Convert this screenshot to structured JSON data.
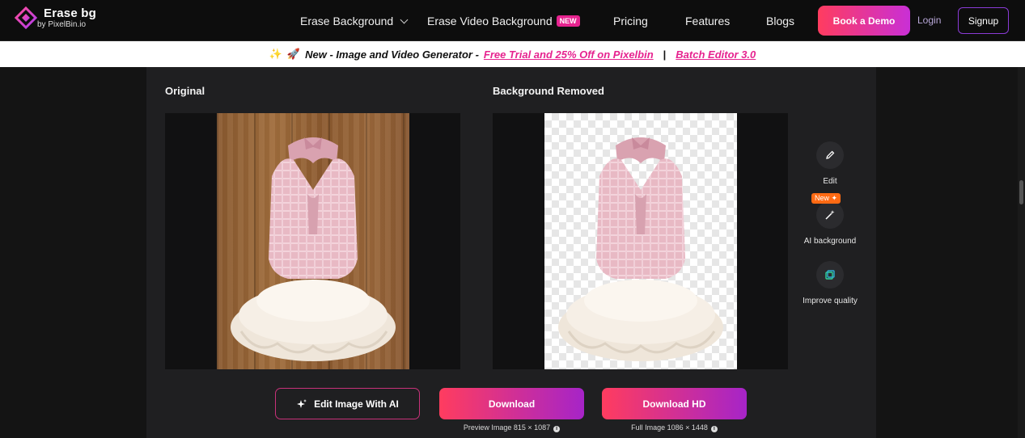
{
  "header": {
    "logo_name": "Erase bg",
    "logo_sub": "by PixelBin.io",
    "nav": {
      "erase_background": "Erase Background",
      "erase_video_background": "Erase Video Background",
      "new_badge": "NEW",
      "pricing": "Pricing",
      "features": "Features",
      "blogs": "Blogs"
    },
    "book_demo": "Book a Demo",
    "login": "Login",
    "signup": "Signup"
  },
  "announcement": {
    "text": "New - Image and Video Generator -",
    "link1": "Free Trial and 25% Off on Pixelbin",
    "separator": "|",
    "link2": "Batch Editor 3.0"
  },
  "main": {
    "original_label": "Original",
    "removed_label": "Background Removed"
  },
  "tools": {
    "edit": "Edit",
    "ai_background": "AI background",
    "new_badge": "New",
    "improve_quality": "Improve quality"
  },
  "actions": {
    "edit_ai": "Edit Image With AI",
    "download": "Download",
    "download_hd": "Download HD",
    "preview_info": "Preview Image 815 × 1087",
    "full_info": "Full Image 1086 × 1448"
  },
  "colors": {
    "accent_pink": "#e6238f",
    "gradient_start": "#ff3c5f",
    "gradient_end": "#a624c8",
    "badge_orange": "#ff6a13"
  }
}
